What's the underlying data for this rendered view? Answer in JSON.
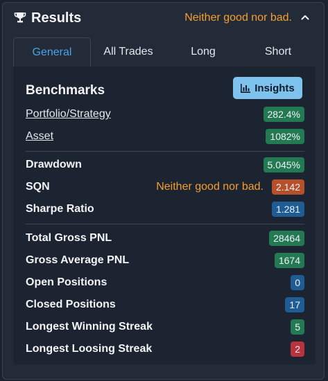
{
  "header": {
    "title": "Results",
    "status": "Neither good nor bad."
  },
  "tabs": [
    {
      "label": "General",
      "active": true
    },
    {
      "label": "All Trades",
      "active": false
    },
    {
      "label": "Long",
      "active": false
    },
    {
      "label": "Short",
      "active": false
    }
  ],
  "benchmarks": {
    "title": "Benchmarks",
    "insights_label": "Insights",
    "portfolio": {
      "label": "Portfolio/Strategy",
      "value": "282.4%"
    },
    "asset": {
      "label": "Asset",
      "value": "1082%"
    }
  },
  "risk": {
    "drawdown": {
      "label": "Drawdown",
      "value": "5.045%"
    },
    "sqn": {
      "label": "SQN",
      "note": "Neither good nor bad.",
      "value": "2.142"
    },
    "sharpe": {
      "label": "Sharpe Ratio",
      "value": "1.281"
    }
  },
  "stats": {
    "total_gross_pnl": {
      "label": "Total Gross PNL",
      "value": "28464"
    },
    "gross_avg_pnl": {
      "label": "Gross Average PNL",
      "value": "1674"
    },
    "open_positions": {
      "label": "Open Positions",
      "value": "0"
    },
    "closed_positions": {
      "label": "Closed Positions",
      "value": "17"
    },
    "win_streak": {
      "label": "Longest Winning Streak",
      "value": "5"
    },
    "loss_streak": {
      "label": "Longest Loosing Streak",
      "value": "2"
    }
  },
  "colors": {
    "accent": "#4ba3e6",
    "warning": "#f59e2e",
    "badge_green": "#237a52",
    "badge_blue": "#1f5c93",
    "badge_orange": "#b5502b",
    "badge_red": "#b8333c"
  },
  "icons": {
    "header": "trophy-icon",
    "collapse": "chevron-up-icon",
    "insights": "bar-chart-icon"
  }
}
